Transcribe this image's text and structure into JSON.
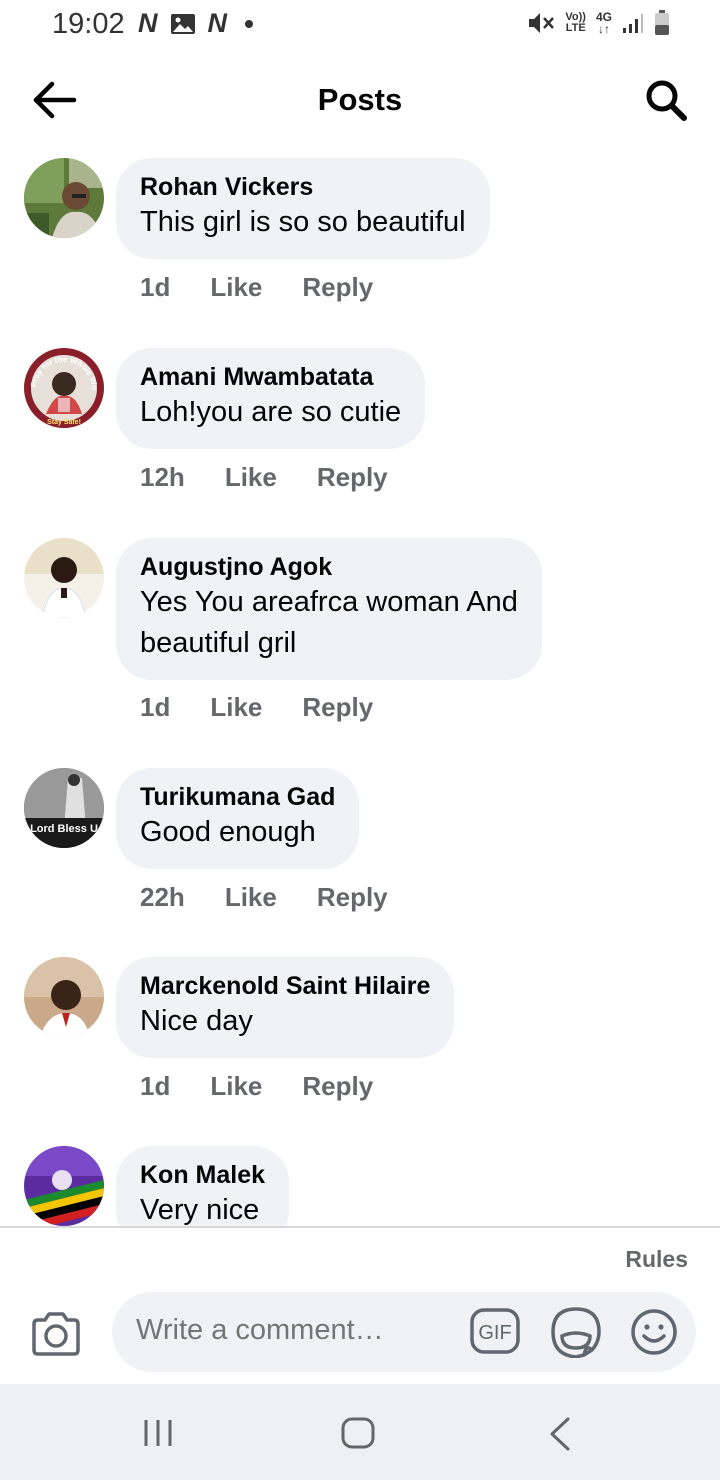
{
  "status_bar": {
    "time": "19:02",
    "left_icons": [
      "netflix-n-icon",
      "image-icon",
      "netflix-n-icon",
      "dot-icon"
    ],
    "network_label_top": "Vo))",
    "network_label_bottom": "LTE",
    "network_type": "4G",
    "right_icons": [
      "mute-icon",
      "volte-icon",
      "4g-icon",
      "signal-icon",
      "battery-icon"
    ]
  },
  "header": {
    "title": "Posts",
    "back_icon": "arrow-left-icon",
    "search_icon": "search-icon"
  },
  "comments": [
    {
      "author": "Rohan Vickers",
      "text": "This girl is so so beautiful",
      "time": "1d",
      "like": "Like",
      "reply": "Reply"
    },
    {
      "author": "Amani Mwambatata",
      "text": "Loh!you are so cutie",
      "time": "12h",
      "like": "Like",
      "reply": "Reply"
    },
    {
      "author": "Augustjno Agok",
      "text_line1": "Yes You areafrca woman And",
      "text_line2": "beautiful gril",
      "time": "1d",
      "like": "Like",
      "reply": "Reply"
    },
    {
      "author": "Turikumana Gad",
      "text": "Good enough",
      "time": "22h",
      "like": "Like",
      "reply": "Reply"
    },
    {
      "author": "Marckenold Saint Hilaire",
      "text": "Nice day",
      "time": "1d",
      "like": "Like",
      "reply": "Reply"
    },
    {
      "author": "Kon Malek",
      "text": "Very nice"
    }
  ],
  "avatar_texts": {
    "amani_top": "Pray for the Whole World",
    "amani_bottom": "Stay Safe!",
    "turikumana": "Lord Bless U"
  },
  "composer": {
    "rules_label": "Rules",
    "placeholder": "Write a comment…",
    "gif_label": "GIF",
    "icons": [
      "camera-icon",
      "gif-icon",
      "sticker-icon",
      "emoji-icon"
    ]
  },
  "nav_bar": {
    "icons": [
      "recent-apps-icon",
      "home-icon",
      "back-icon"
    ]
  },
  "colors": {
    "bubble_bg": "#f0f2f5",
    "meta_text": "#65676b",
    "primary_text": "#050505",
    "placeholder_text": "#8a8d91",
    "nav_bg": "#eef0f2"
  }
}
